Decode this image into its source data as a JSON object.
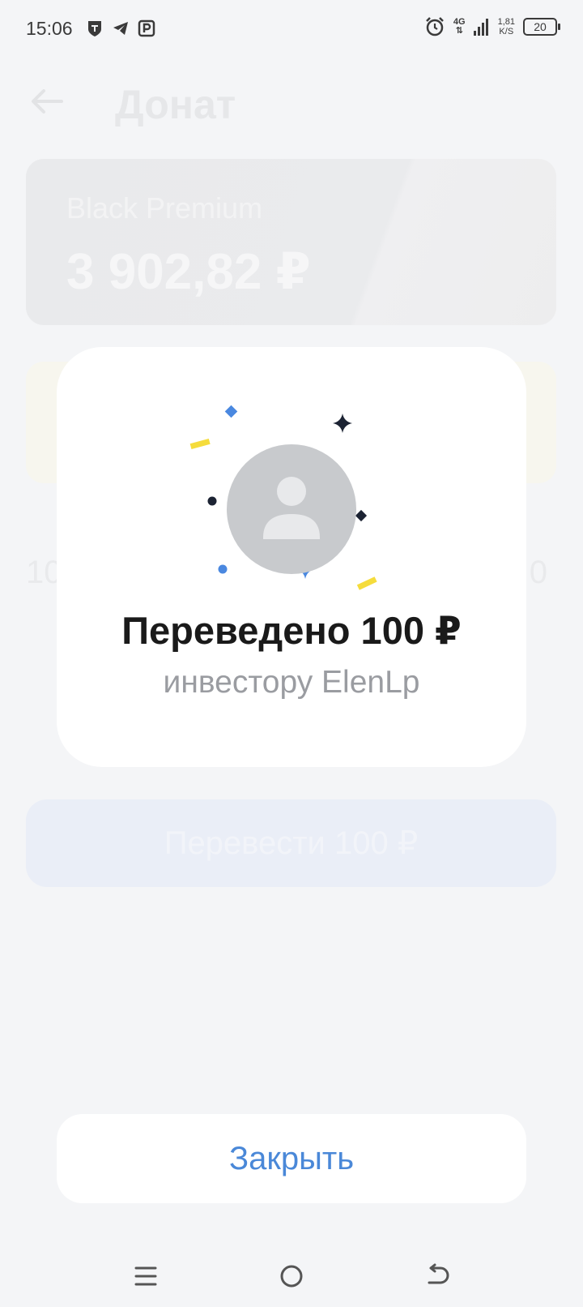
{
  "status_bar": {
    "time": "15:06",
    "network": "4G",
    "speed_value": "1,81",
    "speed_unit": "K/S",
    "battery": "20",
    "icons": [
      "tinkoff-icon",
      "telegram-icon",
      "parking-icon",
      "alarm-icon",
      "signal-icon"
    ]
  },
  "background_page": {
    "title": "Донат",
    "account": {
      "name": "Black Premium",
      "balance": "3 902,82 ₽"
    },
    "amount_left": "10",
    "amount_right": "0",
    "transfer_button_label": "Перевести 100 ₽"
  },
  "modal": {
    "title": "Переведено 100 ₽",
    "subtitle": "инвестору ElenLp"
  },
  "close_button": {
    "label": "Закрыть"
  },
  "colors": {
    "accent": "#4a88d8",
    "confetti_blue": "#4a88e0",
    "confetti_yellow": "#f5dc3c",
    "confetti_dark": "#1c2333"
  },
  "nav_bar": {
    "icons": [
      "menu-icon",
      "home-icon",
      "back-icon"
    ]
  }
}
